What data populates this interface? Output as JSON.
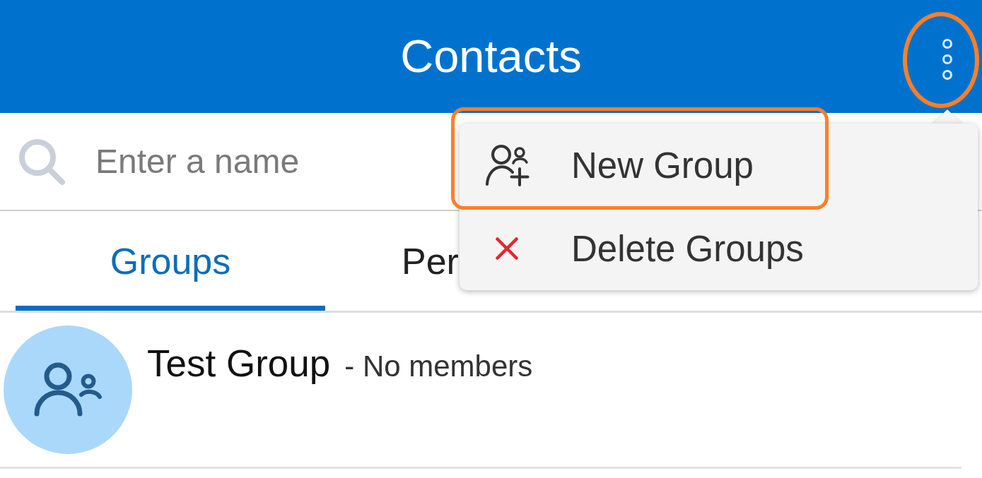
{
  "header": {
    "title": "Contacts",
    "menu_button": {
      "highlighted": true
    }
  },
  "search": {
    "placeholder": "Enter a name"
  },
  "tabs": [
    {
      "label": "Groups",
      "selected": true
    },
    {
      "label": "Per",
      "selected": false
    }
  ],
  "groups": [
    {
      "name": "Test Group",
      "detail": "- No members"
    }
  ],
  "menu": {
    "open": true,
    "items": [
      {
        "kind": "add-group",
        "label": "New Group",
        "highlighted": true
      },
      {
        "kind": "delete",
        "label": "Delete Groups",
        "highlighted": false
      }
    ]
  }
}
